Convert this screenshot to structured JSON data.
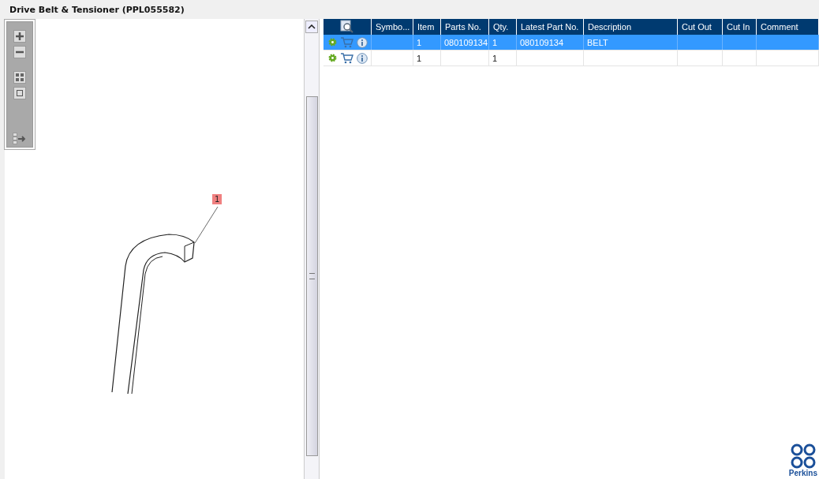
{
  "window": {
    "title": "Drive Belt & Tensioner (PPL055582)"
  },
  "diagram": {
    "callouts": [
      {
        "label": "1"
      }
    ]
  },
  "table": {
    "columns": [
      "Symbo...",
      "Item",
      "Parts No.",
      "Qty.",
      "Latest Part No.",
      "Description",
      "Cut Out",
      "Cut In",
      "Comment"
    ],
    "rows": [
      {
        "selected": true,
        "cells": [
          "",
          "1",
          "080109134",
          "1",
          "080109134",
          "BELT",
          "",
          "",
          ""
        ]
      },
      {
        "selected": false,
        "cells": [
          "",
          "1",
          "",
          "1",
          "",
          "",
          "",
          "",
          ""
        ]
      }
    ]
  },
  "logo": {
    "text": "Perkins"
  }
}
